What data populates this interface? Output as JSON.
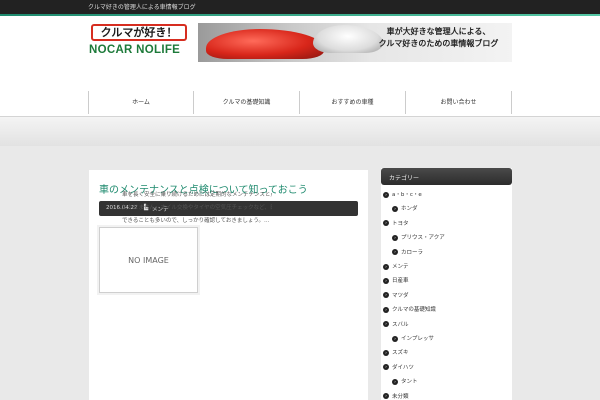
{
  "topbar": {
    "text": "クルマ好きの管理人による車情報ブログ"
  },
  "logo": {
    "top_text": "クルマが好き！",
    "bottom_text": "NOCAR NOLIFE"
  },
  "banner": {
    "line1": "車が大好きな管理人による、",
    "line2": "クルマ好きのための車情報ブログ"
  },
  "nav": {
    "items": [
      {
        "label": "ホーム"
      },
      {
        "label": "クルマの基礎知識"
      },
      {
        "label": "おすすめの車種"
      },
      {
        "label": "お問い合わせ"
      }
    ]
  },
  "post": {
    "title": "車のメンテナンスと点検について知っておこう",
    "date": "2016.04.22",
    "category": "メンテ",
    "thumbnail_label": "NO IMAGE",
    "excerpt_lines": [
      "車を長く安全に乗り続けるためには定期的なメンテナンスと点検が",
      "欠かせません。オイル交換やタイヤの空気圧チェックなど、日頃から",
      "できることも多いので、しっかり確認しておきましょう。…"
    ]
  },
  "sidebar": {
    "heading": "カテゴリー",
    "items": [
      {
        "label": "a・b・c・e",
        "level": 0
      },
      {
        "label": "ホンダ",
        "level": 1
      },
      {
        "label": "トヨタ",
        "level": 0
      },
      {
        "label": "プリウス・アクア",
        "level": 1
      },
      {
        "label": "カローラ",
        "level": 1
      },
      {
        "label": "メンテ",
        "level": 0
      },
      {
        "label": "日産車",
        "level": 0
      },
      {
        "label": "マツダ",
        "level": 0
      },
      {
        "label": "クルマの基礎知識",
        "level": 0
      },
      {
        "label": "スバル",
        "level": 0
      },
      {
        "label": "インプレッサ",
        "level": 1
      },
      {
        "label": "スズキ",
        "level": 0
      },
      {
        "label": "ダイハツ",
        "level": 0
      },
      {
        "label": "タント",
        "level": 1
      },
      {
        "label": "未分類",
        "level": 0
      }
    ]
  },
  "colors": {
    "accent": "#1e8a6e",
    "logo_red": "#d62d20",
    "logo_green": "#1d7a3a"
  }
}
